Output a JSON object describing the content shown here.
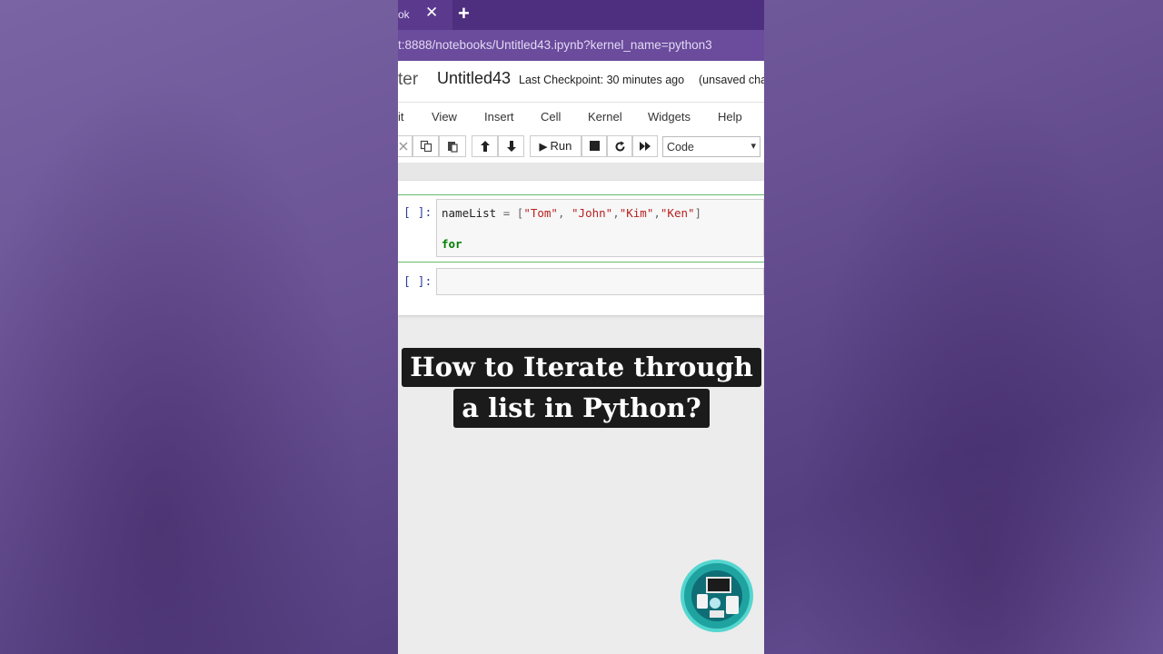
{
  "browser": {
    "tab_label": "ok",
    "tab_close": "✕",
    "new_tab": "+",
    "url": "t:8888/notebooks/Untitled43.ipynb?kernel_name=python3"
  },
  "jupyter": {
    "logo_text": "ter",
    "notebook_title": "Untitled43",
    "checkpoint_label": "Last Checkpoint:",
    "checkpoint_time": "30 minutes ago",
    "unsaved": "(unsaved cha"
  },
  "menu": {
    "items": [
      "it",
      "View",
      "Insert",
      "Cell",
      "Kernel",
      "Widgets",
      "Help"
    ]
  },
  "toolbar": {
    "run_label": "Run",
    "cell_type": "Code",
    "caret": "▾"
  },
  "cells": [
    {
      "prompt": "[ ]:",
      "code_line1": {
        "var": "nameList",
        "op": " = [",
        "s1": "\"Tom\"",
        "sep1": ", ",
        "s2": "\"John\"",
        "sep2": ",",
        "s3": "\"Kim\"",
        "sep3": ",",
        "s4": "\"Ken\"",
        "close": "]"
      },
      "code_line2": "for"
    },
    {
      "prompt": "[ ]:",
      "code": ""
    }
  ],
  "caption": {
    "line1": "How to Iterate through",
    "line2": "a list in Python?"
  },
  "colors": {
    "background": "#6a5295",
    "tab_bar": "#4e2f7f",
    "url_bar": "#6a4b9c",
    "prompt": "#303f9f",
    "string": "#ba2121",
    "keyword": "#008000",
    "badge": "#1fa3a0"
  }
}
